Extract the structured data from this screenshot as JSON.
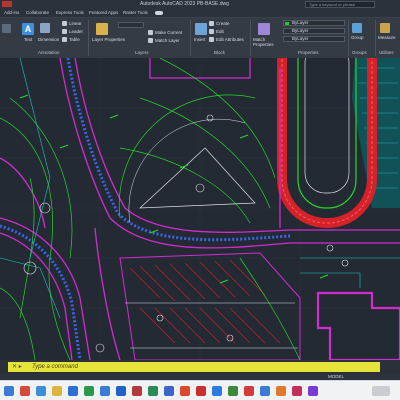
{
  "window": {
    "title": "Autodesk AutoCAD 2023    PB-BASE.dwg",
    "search_placeholder": "Type a keyword or phrase"
  },
  "menu_tabs": [
    "Add-ins",
    "Collaborate",
    "Express Tools",
    "Featured Apps",
    "Raster Tools"
  ],
  "ribbon": {
    "text_label": "Text",
    "dimension_label": "Dimension",
    "linear_label": "Linear",
    "leader_label": "Leader",
    "table_label": "Table",
    "annotation_panel": "Annotation",
    "layer_properties_label": "Layer Properties",
    "layers_panel": "Layers",
    "make_current_label": "Make Current",
    "match_layer_label": "Match Layer",
    "insert_label": "Insert",
    "create_label": "Create",
    "edit_label": "Edit",
    "edit_attributes_label": "Edit Attributes",
    "block_panel": "Block",
    "match_properties_label": "Match Properties",
    "bylayer_color": "ByLayer",
    "bylayer_linetype": "ByLayer",
    "bylayer_lineweight": "ByLayer",
    "properties_panel": "Properties",
    "group_label": "Group",
    "groups_panel": "Groups",
    "measure_label": "Measure",
    "utilities_panel": "Utilities"
  },
  "command_line": {
    "placeholder": "Type a command"
  },
  "status": {
    "model_label": "MODEL"
  },
  "colors": {
    "background": "#232a33",
    "magenta": "#d22bd0",
    "green": "#26d62a",
    "cyan": "#18c9c3",
    "red": "#d3222a",
    "white": "#dfe3e7",
    "command_yellow": "#e6e33a"
  }
}
